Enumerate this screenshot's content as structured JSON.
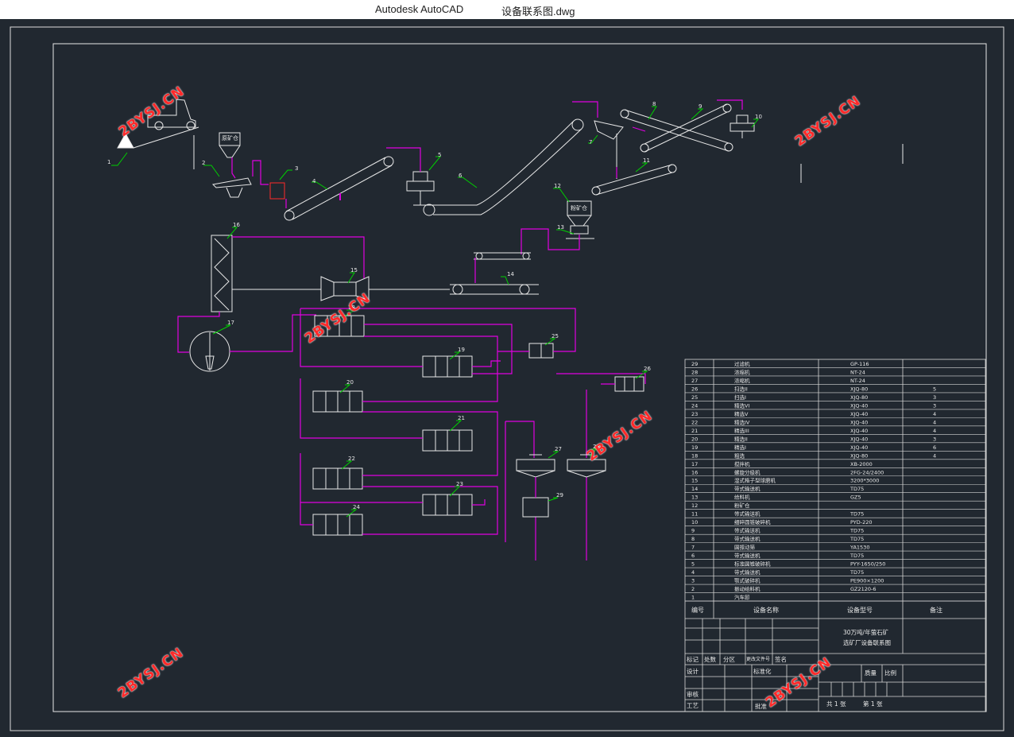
{
  "window": {
    "app_name": "Autodesk AutoCAD",
    "file_name": "设备联系图.dwg"
  },
  "watermark": "2BYSJ.CN",
  "colors": {
    "background": "#212830",
    "line": "#e8e8e8",
    "flow": "#e000e0",
    "leader": "#00d000",
    "accent": "#ff2a2a"
  },
  "drawing": {
    "labels": {
      "l1": "1",
      "l3": "3",
      "l4": "4",
      "l5": "5",
      "l6": "6",
      "l7": "7",
      "l8": "8",
      "l9": "9",
      "l10": "10",
      "l11": "11",
      "l12": "12",
      "l13": "13",
      "l14": "14",
      "l15": "15",
      "l16": "16",
      "l17": "17",
      "l18": "18",
      "l19": "19",
      "l20": "20",
      "l21": "21",
      "l22": "22",
      "l23": "23",
      "l24": "24",
      "l25": "25",
      "l26": "26",
      "l27": "27",
      "l28": "28",
      "l29": "29",
      "l2": "2"
    },
    "raw_bin": "原矿仓",
    "powder_bin": "粉矿仓"
  },
  "parts_table": {
    "rows": [
      {
        "no": "29",
        "name": "过滤机",
        "model": "GP-116",
        "qty": ""
      },
      {
        "no": "28",
        "name": "浓缩机",
        "model": "NT-24",
        "qty": ""
      },
      {
        "no": "27",
        "name": "浓缩机",
        "model": "NT-24",
        "qty": ""
      },
      {
        "no": "26",
        "name": "扫选II",
        "model": "XJQ-80",
        "qty": "5"
      },
      {
        "no": "25",
        "name": "扫选I",
        "model": "XJQ-80",
        "qty": "3"
      },
      {
        "no": "24",
        "name": "精选VI",
        "model": "XJQ-40",
        "qty": "3"
      },
      {
        "no": "23",
        "name": "精选V",
        "model": "XJQ-40",
        "qty": "4"
      },
      {
        "no": "22",
        "name": "精选IV",
        "model": "XJQ-40",
        "qty": "4"
      },
      {
        "no": "21",
        "name": "精选III",
        "model": "XJQ-40",
        "qty": "4"
      },
      {
        "no": "20",
        "name": "精选II",
        "model": "XJQ-40",
        "qty": "3"
      },
      {
        "no": "19",
        "name": "精选I",
        "model": "XJQ-40",
        "qty": "6"
      },
      {
        "no": "18",
        "name": "粗选",
        "model": "XJQ-80",
        "qty": "4"
      },
      {
        "no": "17",
        "name": "搅拌机",
        "model": "XB-2000",
        "qty": ""
      },
      {
        "no": "16",
        "name": "螺旋分级机",
        "model": "2FG-24/2400",
        "qty": ""
      },
      {
        "no": "15",
        "name": "湿式格子型球磨机",
        "model": "3200*3000",
        "qty": ""
      },
      {
        "no": "14",
        "name": "带式输送机",
        "model": "TD75",
        "qty": ""
      },
      {
        "no": "13",
        "name": "给料机",
        "model": "GZ5",
        "qty": ""
      },
      {
        "no": "12",
        "name": "粉矿仓",
        "model": "",
        "qty": ""
      },
      {
        "no": "11",
        "name": "带式输送机",
        "model": "TD75",
        "qty": ""
      },
      {
        "no": "10",
        "name": "细碎圆锥破碎机",
        "model": "PYD-220",
        "qty": ""
      },
      {
        "no": "9",
        "name": "带式输送机",
        "model": "TD75",
        "qty": ""
      },
      {
        "no": "8",
        "name": "带式输送机",
        "model": "TD75",
        "qty": ""
      },
      {
        "no": "7",
        "name": "圆振动筛",
        "model": "YA1530",
        "qty": ""
      },
      {
        "no": "6",
        "name": "带式输送机",
        "model": "TD75",
        "qty": ""
      },
      {
        "no": "5",
        "name": "标准圆锥破碎机",
        "model": "PYY-1650/250",
        "qty": ""
      },
      {
        "no": "4",
        "name": "带式输送机",
        "model": "TD75",
        "qty": ""
      },
      {
        "no": "3",
        "name": "颚式破碎机",
        "model": "PE900×1200",
        "qty": ""
      },
      {
        "no": "2",
        "name": "振动给料机",
        "model": "GZ2120-6",
        "qty": ""
      },
      {
        "no": "1",
        "name": "汽车卸",
        "model": "",
        "qty": ""
      }
    ],
    "header": {
      "no": "编号",
      "name": "设备名称",
      "model": "设备型号",
      "remark": "备注"
    }
  },
  "title_block": {
    "project_line1": "30万吨/年萤石矿",
    "project_line2": "选矿厂设备联系图",
    "mark": "标记",
    "count": "处数",
    "zone": "分区",
    "change_doc": "更改文件号",
    "sign": "签名",
    "design": "设计",
    "standardize": "标准化",
    "review": "审核",
    "process": "工艺",
    "approve": "批准",
    "weight": "质量",
    "scale": "比例",
    "sheets_total": "共 1 张",
    "sheet_no": "第 1 张"
  }
}
